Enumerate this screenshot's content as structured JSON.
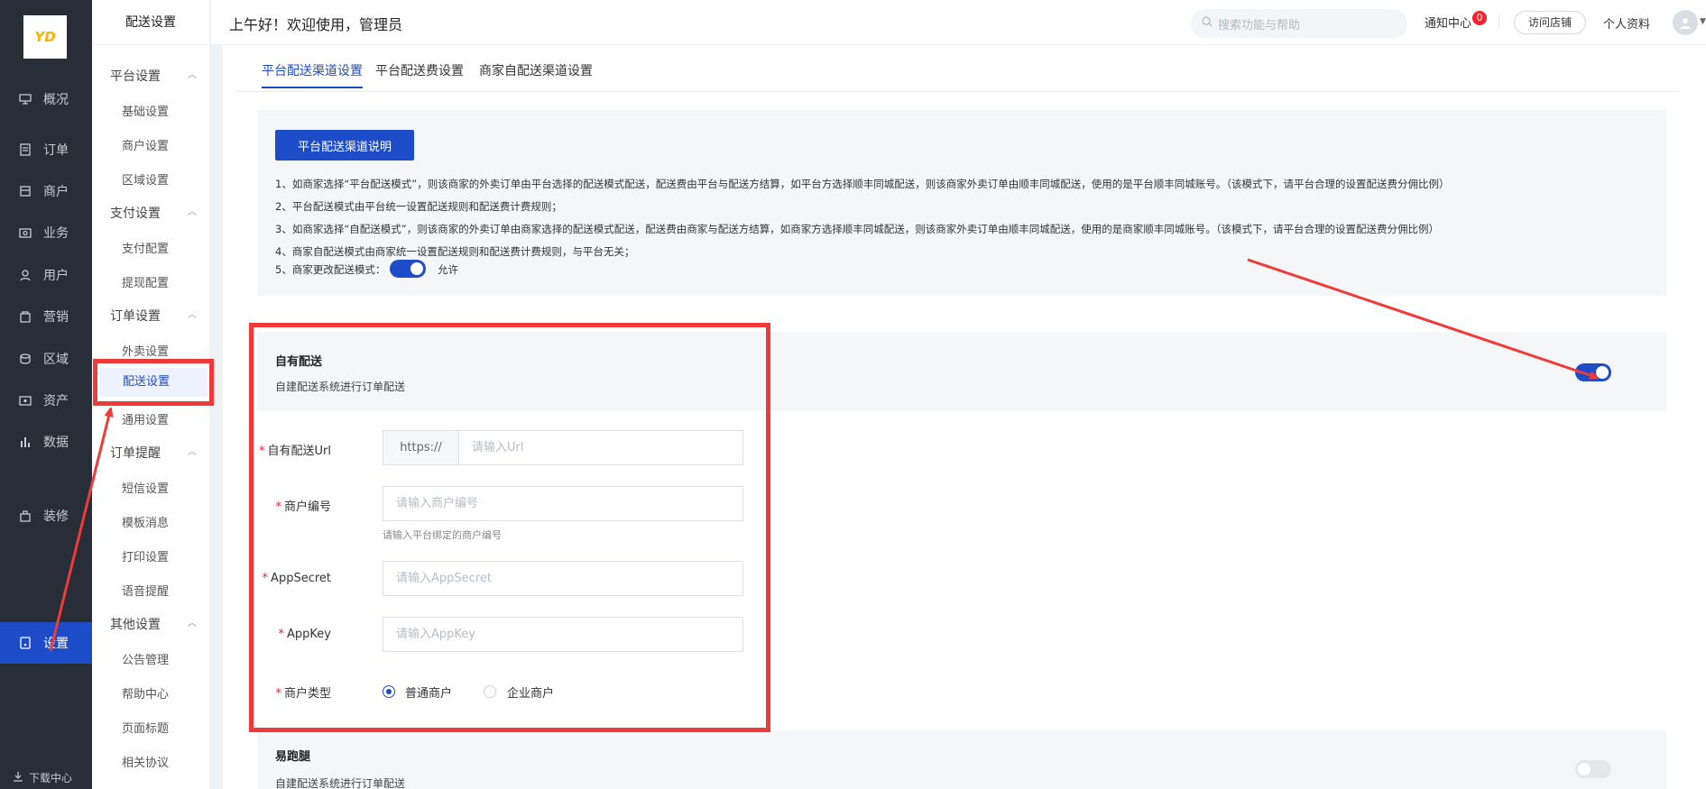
{
  "logo": {
    "text": "YD"
  },
  "nav": {
    "items": [
      {
        "label": "概况",
        "icon": "overview-icon"
      },
      {
        "label": "订单",
        "icon": "order-icon"
      },
      {
        "label": "商户",
        "icon": "merchant-icon"
      },
      {
        "label": "业务",
        "icon": "business-icon"
      },
      {
        "label": "用户",
        "icon": "user-icon"
      },
      {
        "label": "营销",
        "icon": "marketing-icon"
      },
      {
        "label": "区域",
        "icon": "region-icon"
      },
      {
        "label": "资产",
        "icon": "asset-icon"
      },
      {
        "label": "数据",
        "icon": "data-icon"
      },
      {
        "label": "装修",
        "icon": "decorate-icon"
      },
      {
        "label": "设置",
        "icon": "settings-icon"
      }
    ],
    "download": "下载中心"
  },
  "subnav": {
    "title": "配送设置",
    "groups": [
      {
        "label": "平台设置",
        "items": [
          "基础设置",
          "商户设置",
          "区域设置"
        ]
      },
      {
        "label": "支付设置",
        "items": [
          "支付配置",
          "提现配置"
        ]
      },
      {
        "label": "订单设置",
        "items": [
          "外卖设置",
          "配送设置",
          "通用设置"
        ]
      },
      {
        "label": "订单提醒",
        "items": [
          "短信设置",
          "模板消息",
          "打印设置",
          "语音提醒"
        ]
      },
      {
        "label": "其他设置",
        "items": [
          "公告管理",
          "帮助中心",
          "页面标题",
          "相关协议"
        ]
      }
    ]
  },
  "header": {
    "greeting": "上午好！欢迎使用，管理员",
    "search_placeholder": "搜索功能与帮助",
    "notify": "通知中心",
    "notify_count": "0",
    "visit": "访问店铺",
    "profile": "个人资料"
  },
  "tabs": [
    "平台配送渠道设置",
    "平台配送费设置",
    "商家自配送渠道设置"
  ],
  "info": {
    "button": "平台配送渠道说明",
    "lines": [
      "1、如商家选择“平台配送模式”，则该商家的外卖订单由平台选择的配送模式配送，配送费由平台与配送方结算，如平台方选择顺丰同城配送，则该商家外卖订单由顺丰同城配送，使用的是平台顺丰同城账号。（该模式下，请平台合理的设置配送费分佣比例）",
      "2、平台配送模式由平台统一设置配送规则和配送费计费规则；",
      "3、如商家选择“自配送模式”，则该商家的外卖订单由商家选择的配送模式配送，配送费由商家与配送方结算，如商家方选择顺丰同城配送，则该商家外卖订单由顺丰同城配送，使用的是商家顺丰同城账号。（该模式下，请平台合理的设置配送费分佣比例）",
      "4、商家自配送模式由商家统一设置配送规则和配送费计费规则，与平台无关；",
      "5、商家更改配送模式："
    ],
    "allow": "允许",
    "allow_on": true
  },
  "own_delivery": {
    "title": "自有配送",
    "desc": "自建配送系统进行订单配送",
    "enabled": true,
    "url_label": "自有配送Url",
    "url_prefix": "https://",
    "url_placeholder": "请输入Url",
    "merchant_label": "商户编号",
    "merchant_placeholder": "请输入商户编号",
    "merchant_hint": "请输入平台绑定的商户编号",
    "secret_label": "AppSecret",
    "secret_placeholder": "请输入AppSecret",
    "key_label": "AppKey",
    "key_placeholder": "请输入AppKey",
    "type_label": "商户类型",
    "type_options": [
      "普通商户",
      "企业商户"
    ],
    "type_selected": "普通商户"
  },
  "errand": {
    "title": "易跑腿",
    "desc": "自建配送系统进行订单配送",
    "enabled": false
  },
  "colors": {
    "primary": "#1d4cc8",
    "sidebar": "#282e38",
    "annotation": "#ef3a3a"
  }
}
